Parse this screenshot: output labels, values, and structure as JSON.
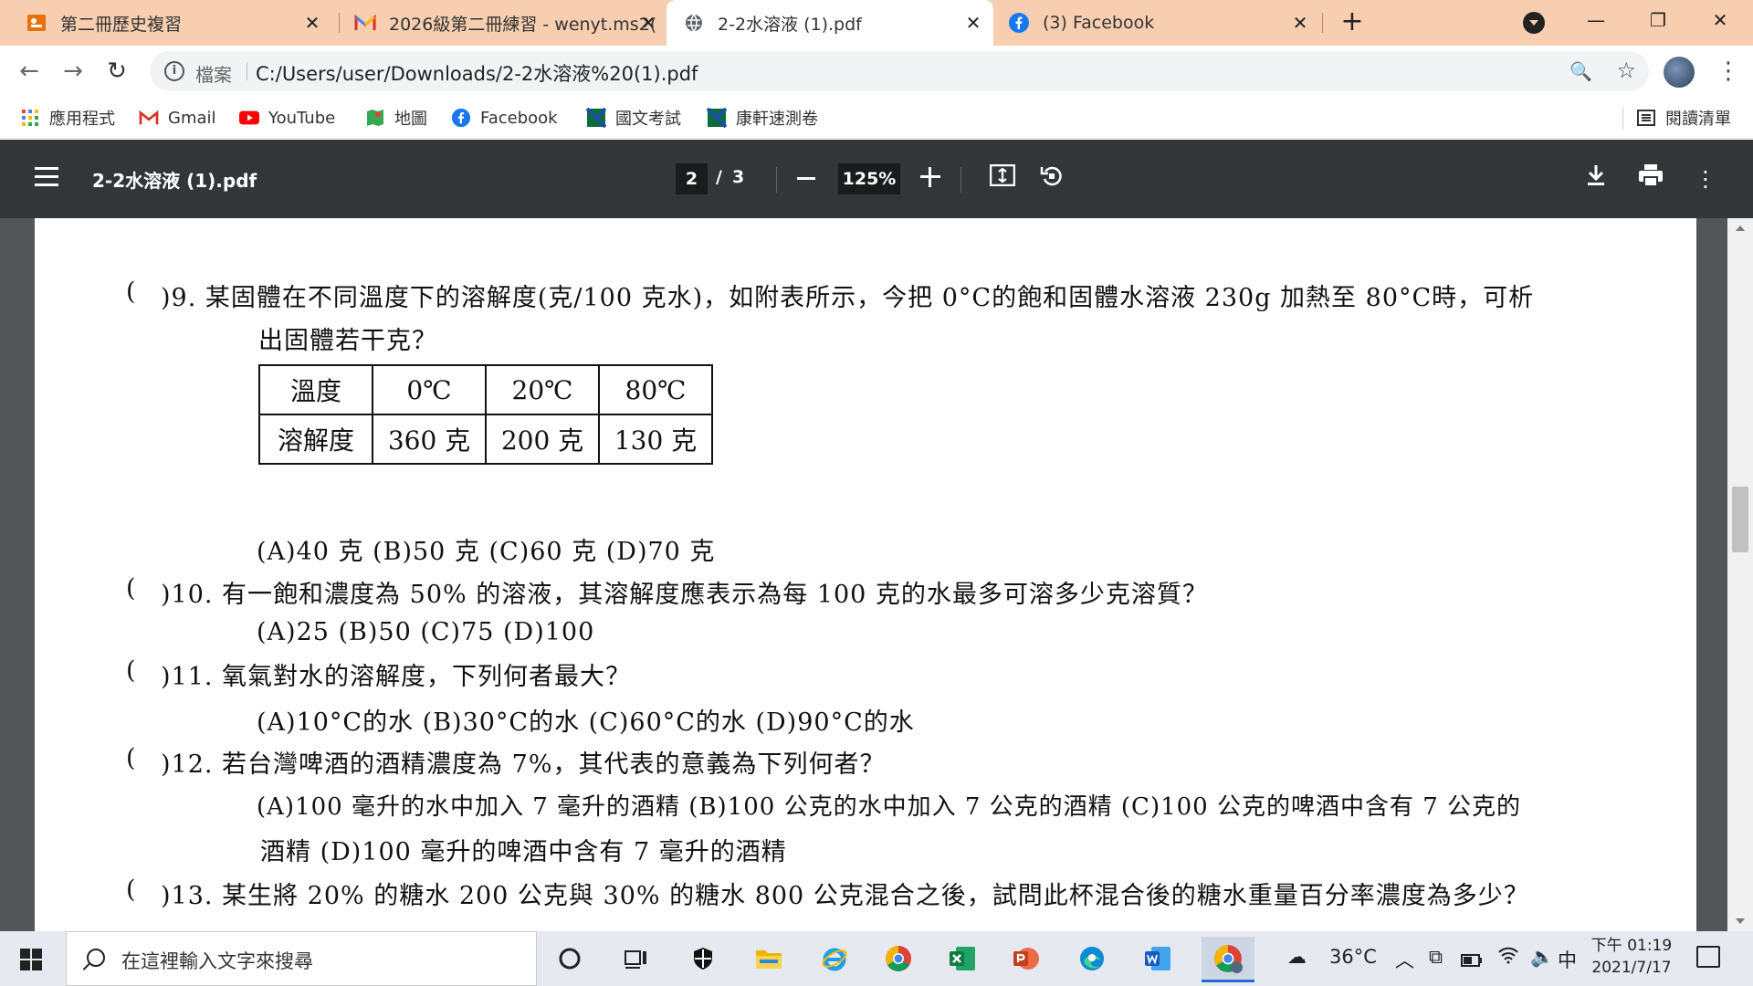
{
  "browser": {
    "tabs": [
      {
        "title": "第二冊歷史複習"
      },
      {
        "title": "2026級第二冊練習 - wenyt.ms2("
      },
      {
        "title": "2-2水溶液 (1).pdf"
      },
      {
        "title": "(3) Facebook"
      }
    ],
    "address": {
      "scheme": "檔案",
      "url": "C:/Users/user/Downloads/2-2水溶液%20(1).pdf"
    },
    "bookmarks": [
      {
        "label": "應用程式",
        "icon": "apps-grid-icon"
      },
      {
        "label": "Gmail",
        "icon": "gmail-icon"
      },
      {
        "label": "YouTube",
        "icon": "youtube-icon"
      },
      {
        "label": "地圖",
        "icon": "maps-icon"
      },
      {
        "label": "Facebook",
        "icon": "facebook-icon"
      },
      {
        "label": "國文考試",
        "icon": "kanghsuan-icon"
      },
      {
        "label": "康軒速測卷",
        "icon": "kanghsuan-icon"
      }
    ],
    "reading_list": "閱讀清單"
  },
  "pdf": {
    "title": "2-2水溶液 (1).pdf",
    "page": "2",
    "page_sep": "/",
    "total": "3",
    "zoom": "125%"
  },
  "document": {
    "paren": "(",
    "q9": {
      "line1": ")9. 某固體在不同溫度下的溶解度(克/100 克水)，如附表所示，今把 0°C的飽和固體水溶液 230g 加熱至 80°C時，可析",
      "line2": "出固體若干克？",
      "options": "(A)40 克  (B)50 克  (C)60 克  (D)70 克"
    },
    "table": {
      "headers": [
        "溫度",
        "0℃",
        "20℃",
        "80℃"
      ],
      "row": [
        "溶解度",
        "360 克",
        "200 克",
        "130 克"
      ]
    },
    "q10": {
      "line1": ")10. 有一飽和濃度為 50% 的溶液，其溶解度應表示為每 100 克的水最多可溶多少克溶質？",
      "options": "(A)25  (B)50  (C)75  (D)100"
    },
    "q11": {
      "line1": ")11. 氧氣對水的溶解度，下列何者最大？",
      "options": "(A)10°C的水  (B)30°C的水  (C)60°C的水  (D)90°C的水"
    },
    "q12": {
      "line1": ")12. 若台灣啤酒的酒精濃度為 7%，其代表的意義為下列何者？",
      "options1": "(A)100 毫升的水中加入 7 毫升的酒精  (B)100 公克的水中加入 7 公克的酒精  (C)100 公克的啤酒中含有 7 公克的",
      "options2": "酒精  (D)100 毫升的啤酒中含有 7 毫升的酒精"
    },
    "q13": {
      "line1": ")13. 某生將 20% 的糖水 200 公克與 30% 的糖水 800 公克混合之後，試問此杯混合後的糖水重量百分率濃度為多少？"
    }
  },
  "taskbar": {
    "search_placeholder": "在這裡輸入文字來搜尋",
    "weather": "36°C",
    "ime": "中",
    "time": "下午 01:19",
    "date": "2021/7/17"
  },
  "colors": {
    "tabstrip": "#f7ceb0",
    "pdf_toolbar": "#323639",
    "viewer_bg": "#525659",
    "taskbar": "#e6e9ef"
  }
}
